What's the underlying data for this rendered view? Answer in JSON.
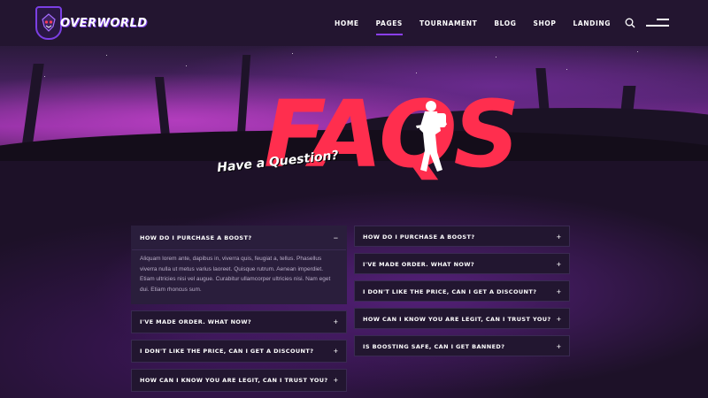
{
  "brand": {
    "name": "OVERWORLD",
    "accent": "#ff2e4e",
    "purple": "#8b3ff5"
  },
  "nav": {
    "items": [
      {
        "label": "HOME"
      },
      {
        "label": "PAGES",
        "active": true
      },
      {
        "label": "TOURNAMENT"
      },
      {
        "label": "BLOG"
      },
      {
        "label": "SHOP"
      },
      {
        "label": "LANDING"
      }
    ],
    "search_icon": "search-icon",
    "menu_icon": "menu-icon"
  },
  "hero": {
    "title": "FAQS",
    "subtitle": "Have a Question?"
  },
  "faq": {
    "left": [
      {
        "question": "HOW DO I PURCHASE A BOOST?",
        "open": true,
        "answer": "Aliquam lorem ante, dapibus in, viverra quis, feugiat a, tellus. Phasellus viverra nulla ut metus varius laoreet. Quisque rutrum. Aenean imperdiet. Etiam ultricies nisi vel augue. Curabitur ullamcorper ultricies nisi. Nam eget dui. Etiam rhoncus sum."
      },
      {
        "question": "I'VE MADE ORDER. WHAT NOW?",
        "open": false
      },
      {
        "question": "I DON'T LIKE THE PRICE, CAN I GET A DISCOUNT?",
        "open": false
      },
      {
        "question": "HOW CAN I KNOW YOU ARE LEGIT, CAN I TRUST YOU?",
        "open": false
      }
    ],
    "right": [
      {
        "question": "HOW DO I PURCHASE A BOOST?",
        "open": false
      },
      {
        "question": "I'VE MADE ORDER. WHAT NOW?",
        "open": false
      },
      {
        "question": "I DON'T LIKE THE PRICE, CAN I GET A DISCOUNT?",
        "open": false
      },
      {
        "question": "HOW CAN I KNOW YOU ARE LEGIT, CAN I TRUST YOU?",
        "open": false
      },
      {
        "question": "IS BOOSTING SAFE, CAN I GET BANNED?",
        "open": false
      }
    ],
    "open_symbol": "−",
    "closed_symbol": "+"
  }
}
